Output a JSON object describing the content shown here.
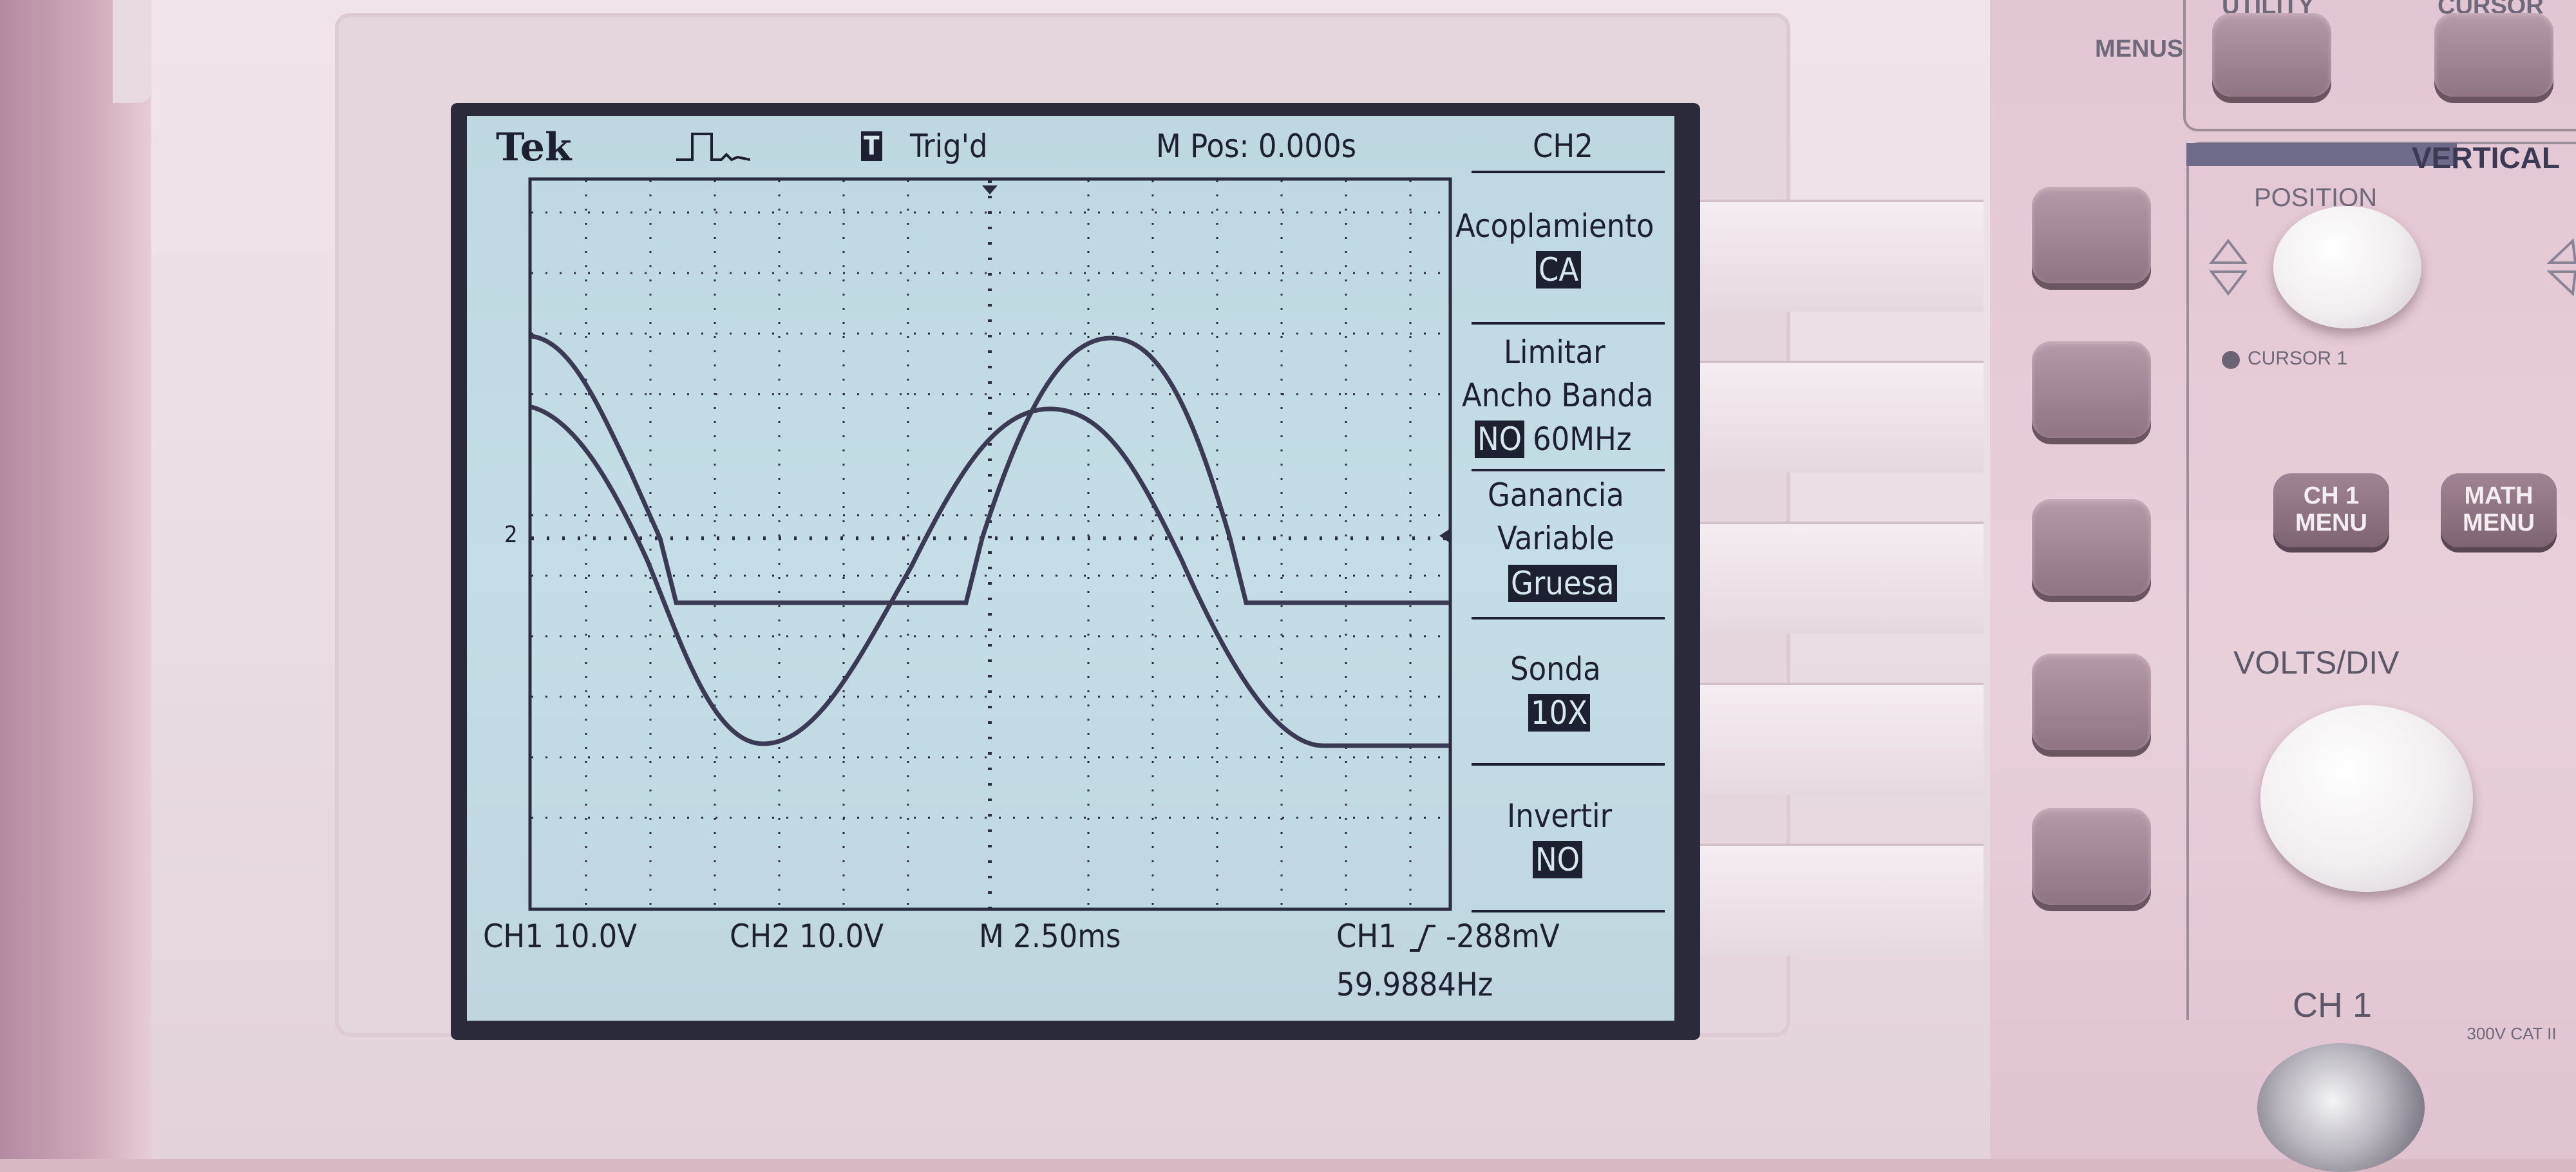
{
  "scope": {
    "brand": "Tek",
    "trigger_state_icon": "T",
    "trigger_state": "Trig'd",
    "m_pos": "M Pos: 0.000s",
    "ch1_scale": "CH1  10.0V",
    "ch2_scale": "CH2  10.0V",
    "timebase": "M 2.50ms",
    "trigger_source": "CH1",
    "trigger_level": "-288mV",
    "frequency": "59.9884Hz",
    "ground_marker": "2"
  },
  "menu": {
    "title": "CH2",
    "coupling_label": "Acoplamiento",
    "coupling_value": "CA",
    "bw_label_1": "Limitar",
    "bw_label_2": "Ancho Banda",
    "bw_value": "NO",
    "bw_value_suffix": "60MHz",
    "gain_label_1": "Ganancia",
    "gain_label_2": "Variable",
    "gain_value": "Gruesa",
    "probe_label": "Sonda",
    "probe_value": "10X",
    "invert_label": "Invertir",
    "invert_value": "NO"
  },
  "panel": {
    "menus_label": "MENUS",
    "utility_label": "UTILITY",
    "cursor_label": "CURSOR",
    "vertical_label": "VERTICAL",
    "position_label": "POSITION",
    "cursor1_label": "CURSOR 1",
    "ch1_menu_label": "CH 1 MENU",
    "math_menu_label": "MATH MENU",
    "volts_div_label": "VOLTS/DIV",
    "ch1_input_label": "CH 1",
    "cat_label": "300V CAT II"
  },
  "colors": {
    "screen_bg": "#c2dbe4",
    "trace": "#3b3a55",
    "text": "#1d2030"
  }
}
